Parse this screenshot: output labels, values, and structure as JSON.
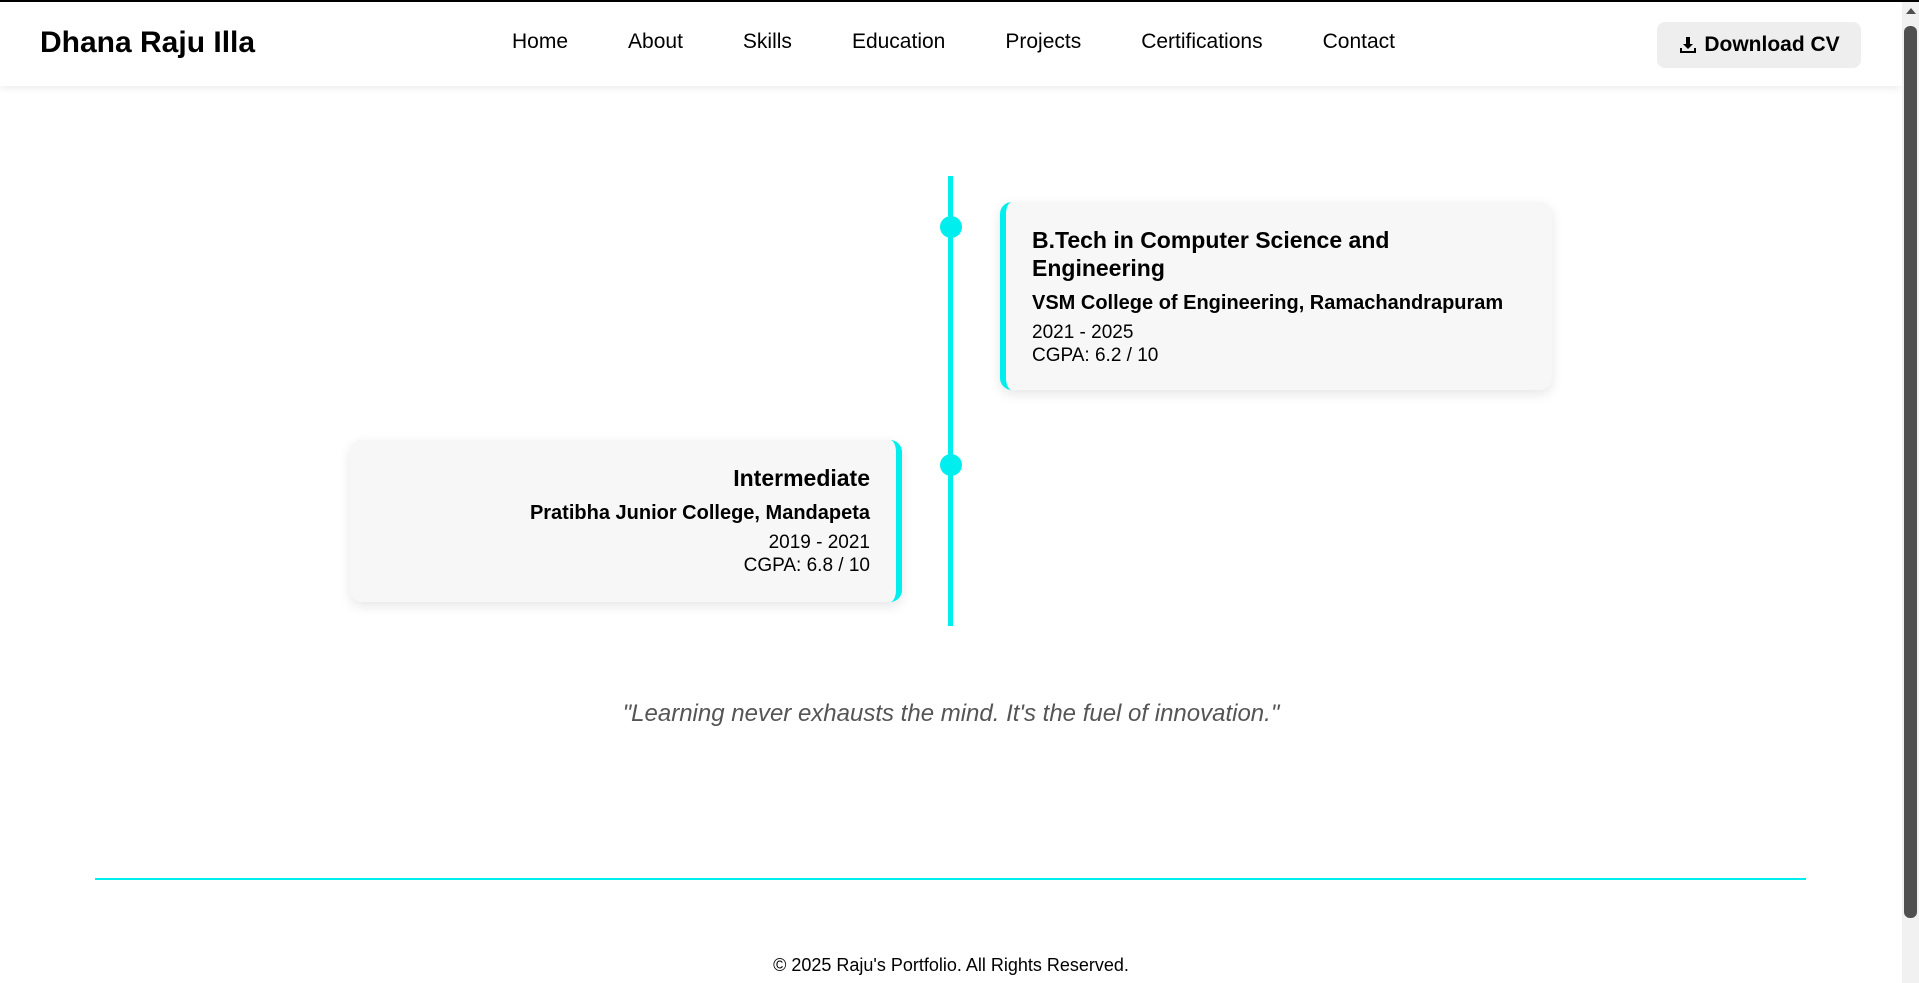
{
  "header": {
    "brand": "Dhana Raju Illa",
    "nav": [
      "Home",
      "About",
      "Skills",
      "Education",
      "Projects",
      "Certifications",
      "Contact"
    ],
    "download_label": "Download CV",
    "download_icon": "download-icon"
  },
  "education": [
    {
      "degree": "B.Tech in Computer Science and Engineering",
      "institution": "VSM College of Engineering, Ramachandrapuram",
      "years": "2021 - 2025",
      "score": "CGPA: 6.2 / 10"
    },
    {
      "degree": "Intermediate",
      "institution": "Pratibha Junior College, Mandapeta",
      "years": "2019 - 2021",
      "score": "CGPA: 6.8 / 10"
    }
  ],
  "quote": "\"Learning never exhausts the mind. It's the fuel of innovation.\"",
  "footer": "© 2025 Raju's Portfolio. All Rights Reserved.",
  "colors": {
    "accent": "#00eeee",
    "card_bg": "#f7f7f7",
    "button_bg": "#eeeeee"
  }
}
